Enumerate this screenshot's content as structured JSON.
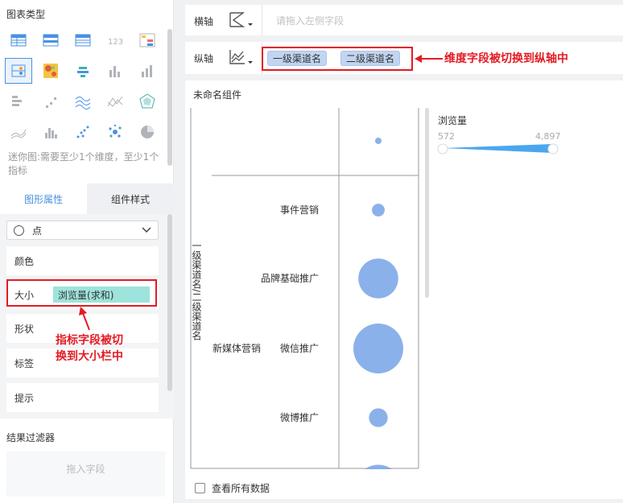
{
  "left_panel": {
    "chart_type_title": "图表类型",
    "mini_hint": "迷你图:需要至少1个维度，至少1个指标",
    "tabs": [
      {
        "label": "图形属性"
      },
      {
        "label": "组件样式"
      }
    ],
    "shape_select": {
      "value": "点"
    },
    "props": [
      {
        "label": "颜色"
      },
      {
        "label": "大小",
        "chip": "浏览量(求和)"
      },
      {
        "label": "形状"
      },
      {
        "label": "标签"
      },
      {
        "label": "提示"
      }
    ],
    "filter_title": "结果过滤器",
    "drop_zone": "拖入字段"
  },
  "x_axis": {
    "label": "横轴",
    "placeholder": "请拖入左侧字段"
  },
  "y_axis": {
    "label": "纵轴",
    "chips": [
      "一级渠道名",
      "二级渠道名"
    ]
  },
  "annotations": {
    "top": "维度字段被切换到纵轴中",
    "left_line1": "指标字段被切",
    "left_line2": "换到大小栏中"
  },
  "canvas": {
    "title": "未命名组件",
    "show_all_label": "查看所有数据"
  },
  "legend": {
    "title": "浏览量",
    "min": "572",
    "max": "4,897"
  },
  "colors": {
    "accent": "#4a90e2",
    "bubble": "#7ea8e8",
    "annotation": "#e31b23",
    "size_chip": "#9ee3dc"
  },
  "chart_data": {
    "type": "scatter",
    "y_axis_title": "一级渠道名/二级渠道名",
    "level1": [
      "新媒体营销"
    ],
    "level2": [
      "事件营销",
      "品牌基础推广",
      "微信推广",
      "微博推广"
    ],
    "size_metric": "浏览量",
    "points": [
      {
        "level1": "",
        "level2": "",
        "value": 572
      },
      {
        "level1": "新媒体营销",
        "level2": "事件营销",
        "value": 1200
      },
      {
        "level1": "新媒体营销",
        "level2": "品牌基础推广",
        "value": 3900
      },
      {
        "level1": "新媒体营销",
        "level2": "微信推广",
        "value": 4897
      },
      {
        "level1": "新媒体营销",
        "level2": "微博推广",
        "value": 1800
      },
      {
        "level1": "新媒体营销",
        "level2": "",
        "value": 4500
      }
    ],
    "size_range": [
      572,
      4897
    ]
  }
}
